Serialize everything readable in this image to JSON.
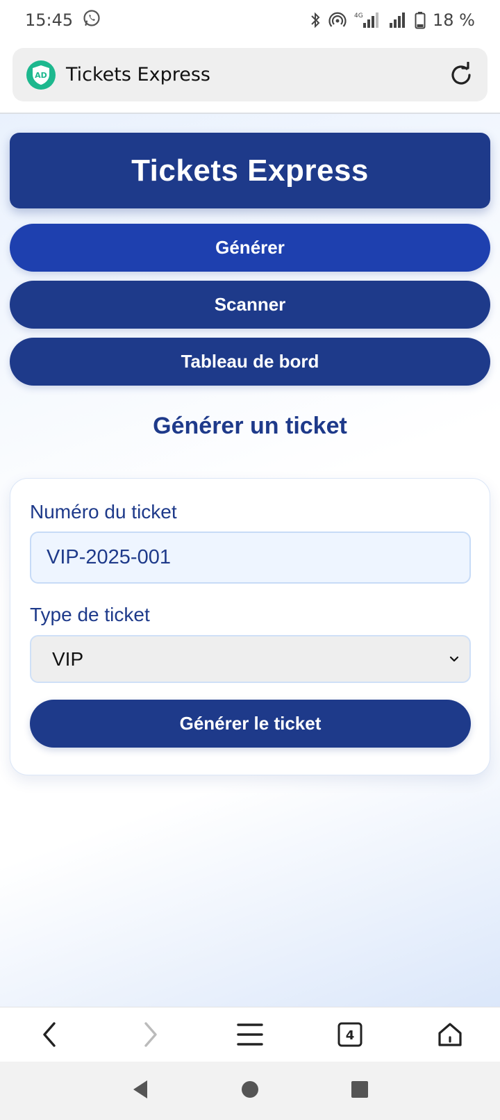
{
  "status_bar": {
    "time": "15:45",
    "battery": "18 %",
    "network": "4G",
    "icons": [
      "whatsapp-icon",
      "bluetooth-icon",
      "hotspot-icon",
      "signal-icon",
      "battery-icon"
    ]
  },
  "browser": {
    "tab_title": "Tickets Express",
    "tab_count": "4",
    "adblock_label": "AD"
  },
  "app": {
    "header_title": "Tickets Express",
    "nav": {
      "generate": "Générer",
      "scan": "Scanner",
      "dashboard": "Tableau de bord"
    },
    "section_title": "Générer un ticket",
    "form": {
      "ticket_number_label": "Numéro du ticket",
      "ticket_number_value": "VIP-2025-001",
      "ticket_type_label": "Type de ticket",
      "ticket_type_value": "VIP",
      "submit_label": "Générer le ticket"
    }
  },
  "colors": {
    "primary": "#1e3a8a",
    "primary_active": "#1e40af",
    "input_bg": "#eef5ff",
    "adblock_green": "#1db88e"
  }
}
